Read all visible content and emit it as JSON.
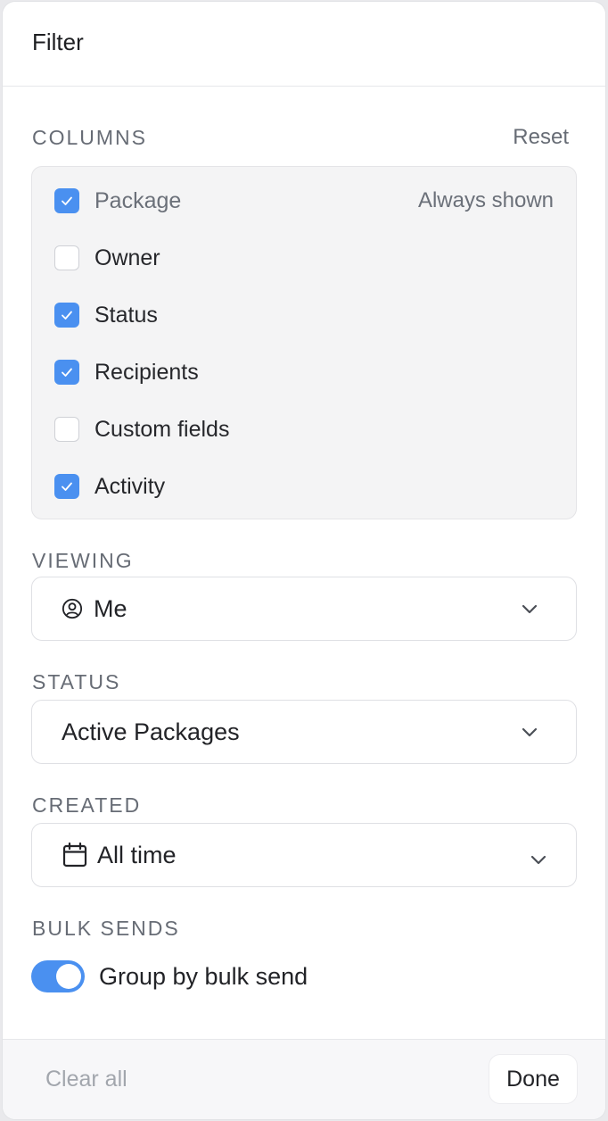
{
  "header": {
    "title": "Filter"
  },
  "columns": {
    "label": "COLUMNS",
    "reset_label": "Reset",
    "items": [
      {
        "label": "Package",
        "checked": true,
        "note": "Always shown"
      },
      {
        "label": "Owner",
        "checked": false
      },
      {
        "label": "Status",
        "checked": true
      },
      {
        "label": "Recipients",
        "checked": true
      },
      {
        "label": "Custom fields",
        "checked": false
      },
      {
        "label": "Activity",
        "checked": true
      }
    ]
  },
  "viewing": {
    "label": "VIEWING",
    "value": "Me",
    "icon": "user-circle-icon"
  },
  "status": {
    "label": "STATUS",
    "value": "Active Packages"
  },
  "created": {
    "label": "CREATED",
    "value": "All time",
    "icon": "calendar-icon"
  },
  "bulk_sends": {
    "label": "BULK SENDS",
    "toggle_label": "Group by bulk send",
    "enabled": true
  },
  "footer": {
    "clear_label": "Clear all",
    "done_label": "Done"
  },
  "colors": {
    "accent": "#4a90f0",
    "muted_text": "#676c75"
  }
}
